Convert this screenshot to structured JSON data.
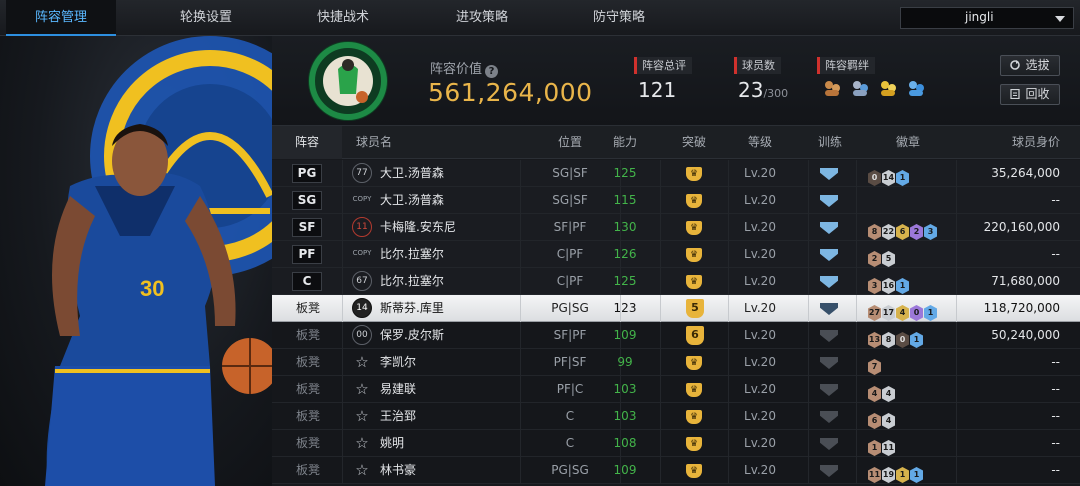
{
  "nav": {
    "tabs": [
      {
        "label": "阵容管理",
        "active": true
      },
      {
        "label": "轮换设置",
        "active": false
      },
      {
        "label": "快捷战术",
        "active": false
      },
      {
        "label": "进攻策略",
        "active": false
      },
      {
        "label": "防守策略",
        "active": false
      }
    ],
    "user": "jingli"
  },
  "team": {
    "value_label": "阵容价值",
    "value": "561,264,000",
    "overall_label": "阵容总评",
    "overall": "121",
    "players_label": "球员数",
    "players": "23",
    "players_max": "/300",
    "bond_label": "阵容羁绊",
    "select_button": "选拔",
    "recycle_button": "回收"
  },
  "columns": [
    "阵容",
    "球员名",
    "位置",
    "能力",
    "突破",
    "等级",
    "训练",
    "徽章",
    "球员身价"
  ],
  "colors": {
    "accent": "#5ab8ff",
    "gold": "#e9b54a",
    "green": "#43b44a",
    "red_tag": "#d0312d"
  },
  "rows": [
    {
      "slot": "PG",
      "jersey": "77",
      "jtype": "num",
      "name": "大卫.汤普森",
      "pos": "SG|SF",
      "rating": "125",
      "brk": "",
      "level": "Lv.20",
      "train": "blue",
      "badges": [
        [
          "0",
          "t0"
        ],
        [
          "14",
          "t2"
        ],
        [
          "1",
          "t5"
        ]
      ],
      "value": "35,264,000"
    },
    {
      "slot": "SG",
      "jersey": "COPY",
      "jtype": "copy",
      "name": "大卫.汤普森",
      "pos": "SG|SF",
      "rating": "115",
      "brk": "",
      "level": "Lv.20",
      "train": "blue",
      "badges": [],
      "value": "--"
    },
    {
      "slot": "SF",
      "jersey": "11",
      "jtype": "red",
      "name": "卡梅隆.安东尼",
      "pos": "SF|PF",
      "rating": "130",
      "brk": "",
      "level": "Lv.20",
      "train": "blue",
      "badges": [
        [
          "8",
          "t1"
        ],
        [
          "22",
          "t2"
        ],
        [
          "6",
          "t3"
        ],
        [
          "2",
          "t4"
        ],
        [
          "3",
          "t5"
        ]
      ],
      "value": "220,160,000"
    },
    {
      "slot": "PF",
      "jersey": "COPY",
      "jtype": "copy",
      "name": "比尔.拉塞尔",
      "pos": "C|PF",
      "rating": "126",
      "brk": "",
      "level": "Lv.20",
      "train": "blue",
      "badges": [
        [
          "2",
          "t1"
        ],
        [
          "5",
          "t2"
        ]
      ],
      "value": "--"
    },
    {
      "slot": "C",
      "jersey": "67",
      "jtype": "num",
      "name": "比尔.拉塞尔",
      "pos": "C|PF",
      "rating": "125",
      "brk": "",
      "level": "Lv.20",
      "train": "blue",
      "badges": [
        [
          "3",
          "t1"
        ],
        [
          "16",
          "t2"
        ],
        [
          "1",
          "t5"
        ]
      ],
      "value": "71,680,000"
    },
    {
      "slot": "板凳",
      "jersey": "14",
      "jtype": "dark",
      "name": "斯蒂芬.库里",
      "pos": "PG|SG",
      "rating": "123",
      "brk": "5",
      "level": "Lv.20",
      "train": "dark",
      "badges": [
        [
          "27",
          "t1"
        ],
        [
          "17",
          "t2"
        ],
        [
          "4",
          "t3"
        ],
        [
          "0",
          "t4"
        ],
        [
          "1",
          "t5"
        ]
      ],
      "value": "118,720,000",
      "selected": true
    },
    {
      "slot": "板凳",
      "jersey": "00",
      "jtype": "plain",
      "name": "保罗.皮尔斯",
      "pos": "SF|PF",
      "rating": "109",
      "brk": "6",
      "level": "Lv.20",
      "train": "grey",
      "badges": [
        [
          "13",
          "t1"
        ],
        [
          "8",
          "t2"
        ],
        [
          "0",
          "t0"
        ],
        [
          "1",
          "t5"
        ]
      ],
      "value": "50,240,000"
    },
    {
      "slot": "板凳",
      "jersey": "☆",
      "jtype": "star",
      "name": "李凯尔",
      "pos": "PF|SF",
      "rating": "99",
      "brk": "",
      "level": "Lv.20",
      "train": "grey",
      "badges": [
        [
          "7",
          "t1"
        ]
      ],
      "value": "--"
    },
    {
      "slot": "板凳",
      "jersey": "☆",
      "jtype": "star",
      "name": "易建联",
      "pos": "PF|C",
      "rating": "103",
      "brk": "",
      "level": "Lv.20",
      "train": "grey",
      "badges": [
        [
          "4",
          "t1"
        ],
        [
          "4",
          "t2"
        ]
      ],
      "value": "--"
    },
    {
      "slot": "板凳",
      "jersey": "☆",
      "jtype": "star",
      "name": "王治郅",
      "pos": "C",
      "rating": "103",
      "brk": "",
      "level": "Lv.20",
      "train": "grey",
      "badges": [
        [
          "6",
          "t1"
        ],
        [
          "4",
          "t2"
        ]
      ],
      "value": "--"
    },
    {
      "slot": "板凳",
      "jersey": "☆",
      "jtype": "star",
      "name": "姚明",
      "pos": "C",
      "rating": "108",
      "brk": "",
      "level": "Lv.20",
      "train": "grey",
      "badges": [
        [
          "1",
          "t1"
        ],
        [
          "11",
          "t2"
        ]
      ],
      "value": "--"
    },
    {
      "slot": "板凳",
      "jersey": "☆",
      "jtype": "star",
      "name": "林书豪",
      "pos": "PG|SG",
      "rating": "109",
      "brk": "",
      "level": "Lv.20",
      "train": "grey",
      "badges": [
        [
          "11",
          "t1"
        ],
        [
          "19",
          "t2"
        ],
        [
          "1",
          "t3"
        ],
        [
          "1",
          "t5"
        ]
      ],
      "value": "--"
    }
  ]
}
